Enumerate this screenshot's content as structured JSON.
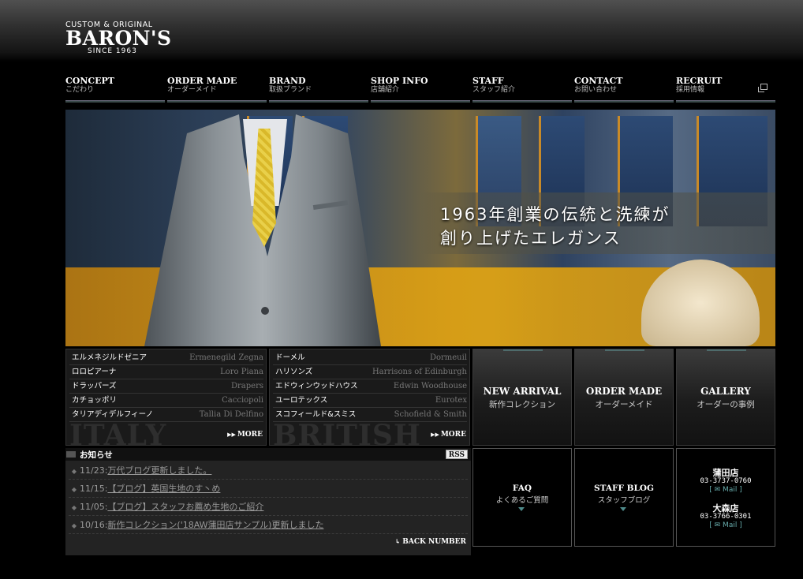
{
  "logo": {
    "tagline": "CUSTOM & ORIGINAL",
    "brand": "BARON'S",
    "since": "SINCE 1963"
  },
  "nav": [
    {
      "en": "CONCEPT",
      "ja": "こだわり"
    },
    {
      "en": "ORDER MADE",
      "ja": "オーダーメイド"
    },
    {
      "en": "BRAND",
      "ja": "取扱ブランド"
    },
    {
      "en": "SHOP INFO",
      "ja": "店舗紹介"
    },
    {
      "en": "STAFF",
      "ja": "スタッフ紹介"
    },
    {
      "en": "CONTACT",
      "ja": "お問い合わせ"
    },
    {
      "en": "RECRUIT",
      "ja": "採用情報"
    }
  ],
  "hero": {
    "line1": "1963年創業の伝統と洗練が",
    "line2": "創り上げたエレガンス"
  },
  "italy": {
    "label": "ITALY",
    "more": "MORE",
    "brands": [
      {
        "jp": "エルメネジルドゼニア",
        "en": "Ermenegild Zegna"
      },
      {
        "jp": "ロロピアーナ",
        "en": "Loro Piana"
      },
      {
        "jp": "ドラッパーズ",
        "en": "Drapers"
      },
      {
        "jp": "カチョッポリ",
        "en": "Cacciopoli"
      },
      {
        "jp": "タリアディデルフィーノ",
        "en": "Tallia Di Delfino"
      }
    ]
  },
  "british": {
    "label": "BRITISH",
    "more": "MORE",
    "brands": [
      {
        "jp": "ドーメル",
        "en": "Dormeuil"
      },
      {
        "jp": "ハリソンズ",
        "en": "Harrisons of Edinburgh"
      },
      {
        "jp": "エドウィンウッドハウス",
        "en": "Edwin Woodhouse"
      },
      {
        "jp": "ユーロテックス",
        "en": "Eurotex"
      },
      {
        "jp": "スコフィールド&スミス",
        "en": "Schofield & Smith"
      }
    ]
  },
  "features": [
    {
      "title": "NEW ARRIVAL",
      "sub": "新作コレクション"
    },
    {
      "title": "ORDER MADE",
      "sub": "オーダーメイド"
    },
    {
      "title": "GALLERY",
      "sub": "オーダーの事例"
    }
  ],
  "news": {
    "heading": "お知らせ",
    "rss": "RSS",
    "back": "BACK NUMBER",
    "items": [
      {
        "date": "11/23:",
        "title": "万代ブログ更新しました。"
      },
      {
        "date": "11/15:",
        "title": "【ブログ】英国生地のす丶め"
      },
      {
        "date": "11/05:",
        "title": "【ブログ】スタッフお薦め生地のご紹介"
      },
      {
        "date": "10/16:",
        "title": "新作コレクション('18AW蒲田店サンプル)更新しました"
      }
    ]
  },
  "faq": {
    "title": "FAQ",
    "sub": "よくあるご質問"
  },
  "staffblog": {
    "title": "STAFF BLOG",
    "sub": "スタッフブログ"
  },
  "shops": [
    {
      "name": "蒲田店",
      "tel": "03-3737-0760",
      "mail": "[ ✉ Mail ]"
    },
    {
      "name": "大森店",
      "tel": "03-3766-0301",
      "mail": "[ ✉ Mail ]"
    }
  ]
}
